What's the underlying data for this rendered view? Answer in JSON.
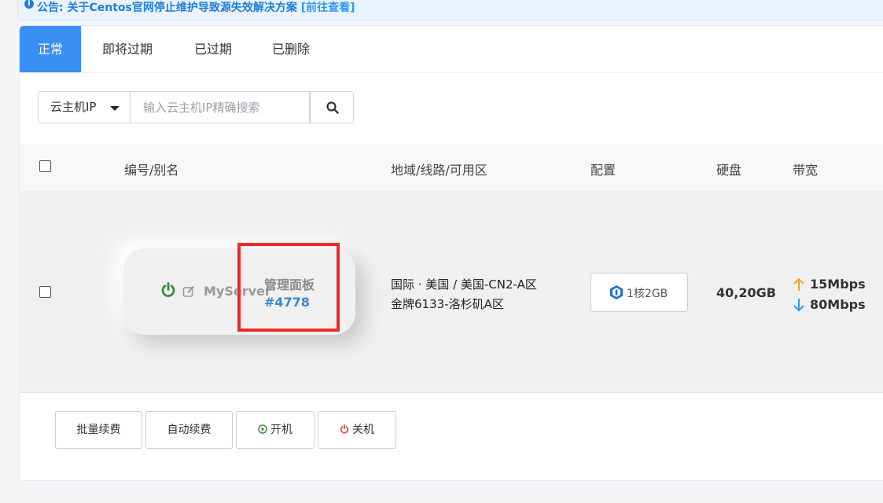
{
  "notice": {
    "icon": "info-icon",
    "text": "公告: 关于Centos官网停止维护导致源失效解决方案",
    "link": "[前往查看]"
  },
  "tabs": [
    {
      "label": "正常",
      "active": true
    },
    {
      "label": "即将过期",
      "active": false
    },
    {
      "label": "已过期",
      "active": false
    },
    {
      "label": "已删除",
      "active": false
    }
  ],
  "filter": {
    "field_selected": "云主机IP",
    "placeholder": "输入云主机IP精确搜索",
    "search_icon": "search-icon"
  },
  "table": {
    "headers": [
      "编号/别名",
      "地域/线路/可用区",
      "配置",
      "硬盘",
      "带宽"
    ],
    "rows": [
      {
        "status_icon": "power-icon",
        "status_color": "#3c8c3c",
        "edit_icon": "edit-icon",
        "alias": "MyServer",
        "panel_label": "管理面板",
        "id": "#4778",
        "region_line1": "国际 · 美国 / 美国-CN2-A区",
        "region_line2": "金牌6133-洛杉矶A区",
        "config_icon": "cpu-icon",
        "config": "1核2GB",
        "disk": "40,20GB",
        "bandwidth_up": "15Mbps",
        "bandwidth_down": "80Mbps",
        "up_color": "#f0a030",
        "down_color": "#2a9af2"
      }
    ]
  },
  "actions": {
    "batch_renew": "批量续费",
    "auto_renew": "自动续费",
    "power_on": "开机",
    "power_off": "关机",
    "power_on_color": "#3c8c3c",
    "power_off_color": "#e64a3c"
  },
  "colors": {
    "accent": "#3a8ff5",
    "highlight_box": "#ee2a24",
    "link": "#3d86c6"
  }
}
